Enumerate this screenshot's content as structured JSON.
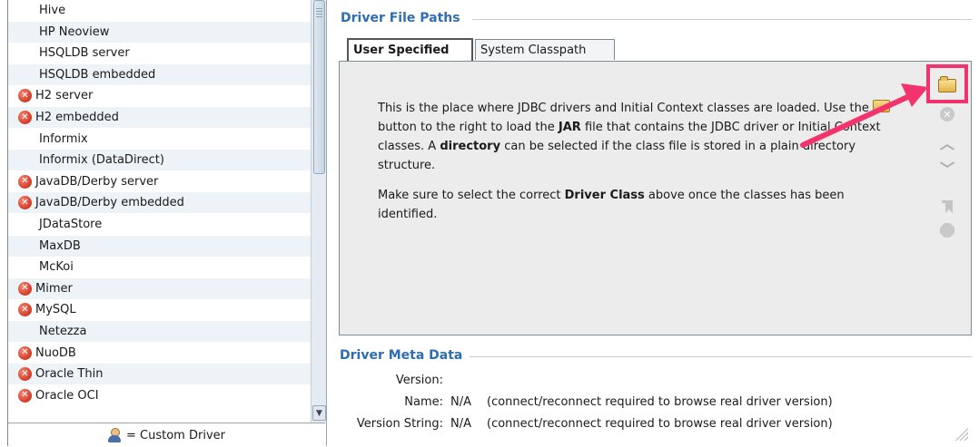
{
  "drivers": [
    {
      "label": "Hive",
      "error": false
    },
    {
      "label": "HP Neoview",
      "error": false
    },
    {
      "label": "HSQLDB server",
      "error": false
    },
    {
      "label": "HSQLDB embedded",
      "error": false
    },
    {
      "label": "H2 server",
      "error": true
    },
    {
      "label": "H2 embedded",
      "error": true
    },
    {
      "label": "Informix",
      "error": false
    },
    {
      "label": "Informix (DataDirect)",
      "error": false
    },
    {
      "label": "JavaDB/Derby server",
      "error": true
    },
    {
      "label": "JavaDB/Derby embedded",
      "error": true
    },
    {
      "label": "JDataStore",
      "error": false
    },
    {
      "label": "MaxDB",
      "error": false
    },
    {
      "label": "McKoi",
      "error": false
    },
    {
      "label": "Mimer",
      "error": true
    },
    {
      "label": "MySQL",
      "error": true
    },
    {
      "label": "Netezza",
      "error": false
    },
    {
      "label": "NuoDB",
      "error": true
    },
    {
      "label": "Oracle Thin",
      "error": true
    },
    {
      "label": "Oracle OCI",
      "error": true
    }
  ],
  "legend": {
    "text": "= Custom Driver",
    "icon": "user-icon"
  },
  "driver_file_paths": {
    "title": "Driver File Paths",
    "tabs": [
      {
        "label": "User Specified",
        "active": true
      },
      {
        "label": "System Classpath",
        "active": false
      }
    ],
    "p1": {
      "a": "This is the place where JDBC drivers and Initial Context classes are loaded. Use the ",
      "b": " button to the right to load the ",
      "jar": "JAR",
      "c": " file that contains the JDBC driver or Initial Context classes. A ",
      "directory": "directory",
      "d": " can be selected if the class file is stored in a plain directory structure."
    },
    "p2": {
      "a": "Make sure to select the correct ",
      "driver_class": "Driver Class",
      "b": " above once the classes has been identified."
    },
    "toolbar_icons": [
      "folder-icon",
      "remove-icon",
      "move-up-icon",
      "move-down-icon",
      "jar-icon",
      "stop-icon"
    ]
  },
  "driver_meta_data": {
    "title": "Driver Meta Data",
    "rows": [
      {
        "label": "Version:",
        "value": "",
        "note": ""
      },
      {
        "label": "Name:",
        "value": "N/A",
        "note": "(connect/reconnect required to browse real driver version)"
      },
      {
        "label": "Version String:",
        "value": "N/A",
        "note": "(connect/reconnect required to browse real driver version)"
      }
    ]
  },
  "colors": {
    "section_title": "#2e6db0",
    "highlight": "#f2336d",
    "error": "#d9412b"
  }
}
